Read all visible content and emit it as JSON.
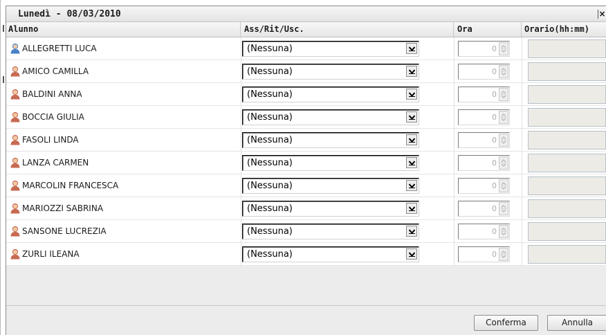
{
  "dialog": {
    "title": "Lunedì - 08/03/2010",
    "close_glyph": "×"
  },
  "columns": {
    "alunno": "Alunno",
    "ass": "Ass/Rit/Usc.",
    "ora": "Ora",
    "orario": "Orario(hh:mm)"
  },
  "icons": {
    "male_student": "male-student-icon",
    "female_student": "female-student-icon",
    "select_arrow": "chevron-down-icon",
    "spinner": "spinner-icon",
    "close": "close-icon"
  },
  "colors": {
    "male_icon": "#4a80c8",
    "female_icon": "#c76a52"
  },
  "students": [
    {
      "name": "ALLEGRETTI LUCA",
      "gender": "male",
      "status": "(Nessuna)",
      "ora": "0",
      "orario": ""
    },
    {
      "name": "AMICO CAMILLA",
      "gender": "female",
      "status": "(Nessuna)",
      "ora": "0",
      "orario": ""
    },
    {
      "name": "BALDINI ANNA",
      "gender": "female",
      "status": "(Nessuna)",
      "ora": "0",
      "orario": ""
    },
    {
      "name": "BOCCIA GIULIA",
      "gender": "female",
      "status": "(Nessuna)",
      "ora": "0",
      "orario": ""
    },
    {
      "name": "FASOLI LINDA",
      "gender": "female",
      "status": "(Nessuna)",
      "ora": "0",
      "orario": ""
    },
    {
      "name": "LANZA CARMEN",
      "gender": "female",
      "status": "(Nessuna)",
      "ora": "0",
      "orario": ""
    },
    {
      "name": "MARCOLIN FRANCESCA",
      "gender": "female",
      "status": "(Nessuna)",
      "ora": "0",
      "orario": ""
    },
    {
      "name": "MARIOZZI SABRINA",
      "gender": "female",
      "status": "(Nessuna)",
      "ora": "0",
      "orario": ""
    },
    {
      "name": "SANSONE LUCREZIA",
      "gender": "female",
      "status": "(Nessuna)",
      "ora": "0",
      "orario": ""
    },
    {
      "name": "ZURLI ILEANA",
      "gender": "female",
      "status": "(Nessuna)",
      "ora": "0",
      "orario": ""
    }
  ],
  "buttons": {
    "confirm": "Conferma",
    "cancel": "Annulla"
  }
}
